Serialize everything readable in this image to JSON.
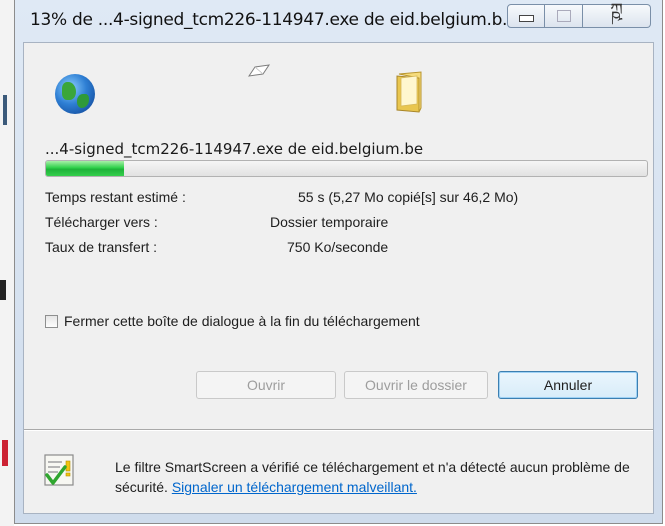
{
  "window": {
    "title": "13% de ...4-signed_tcm226-114947.exe de eid.belgium.b...",
    "controls": {
      "minimize_icon": "minimize-icon",
      "maximize_icon": "maximize-icon",
      "close_icon": "close-icon",
      "close_glyph": "ཀྵ"
    }
  },
  "download": {
    "filename": "...4-signed_tcm226-114947.exe de eid.belgium.be",
    "progress_percent": 13,
    "info": [
      {
        "label": "Temps restant estimé :",
        "value": "55 s (5,27 Mo copié[s] sur 46,2 Mo)"
      },
      {
        "label": "Télécharger vers :",
        "value": "Dossier temporaire"
      },
      {
        "label": "Taux de transfert :",
        "value": "750 Ko/seconde"
      }
    ],
    "close_on_finish": {
      "label": "Fermer cette boîte de dialogue à la fin du téléchargement",
      "checked": false
    }
  },
  "buttons": {
    "open": "Ouvrir",
    "open_folder": "Ouvrir le dossier",
    "cancel": "Annuler"
  },
  "smartscreen": {
    "text": "Le filtre SmartScreen a vérifié ce téléchargement et n'a détecté aucun problème de sécurité. ",
    "link": "Signaler un téléchargement malveillant."
  },
  "icons": {
    "source": "globe-icon",
    "destination": "folder-icon",
    "transfer": "paper-icon",
    "security": "smartscreen-shield-icon"
  },
  "colors": {
    "progress": "#2fd04a",
    "link": "#0066cc",
    "primary_button_border": "#3c7fb1"
  }
}
